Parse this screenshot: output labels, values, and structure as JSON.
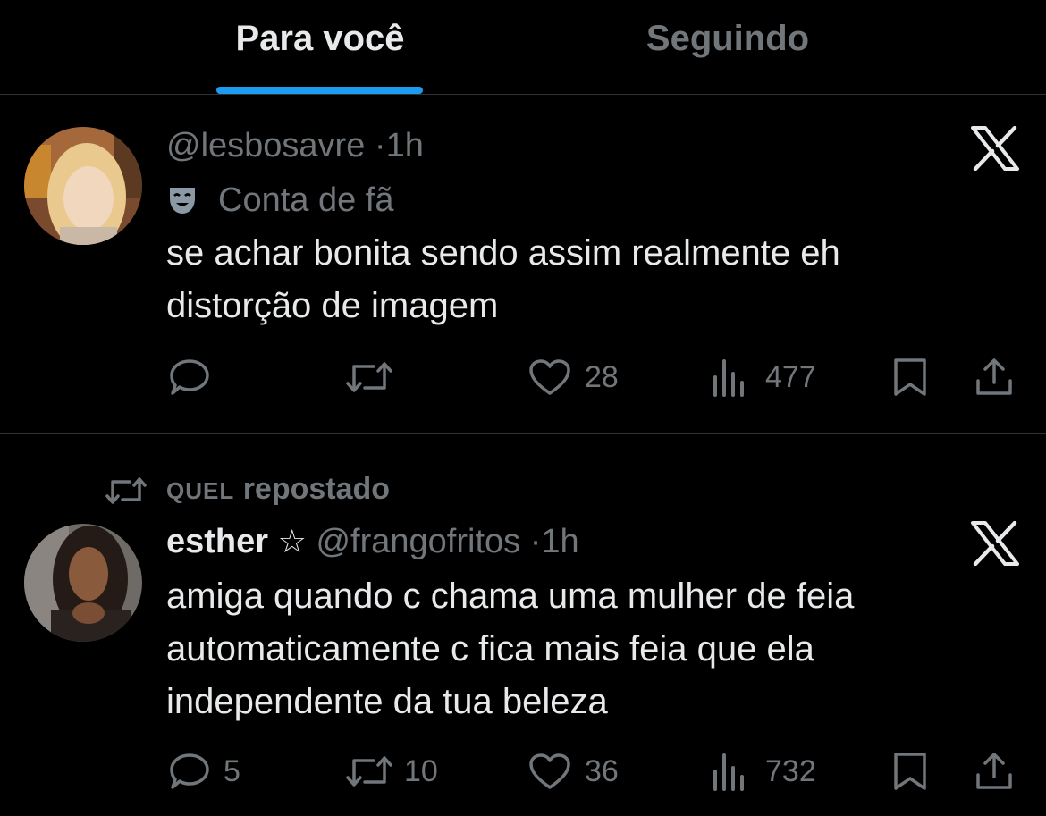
{
  "tabs": {
    "for_you": "Para você",
    "following": "Seguindo"
  },
  "colors": {
    "accent": "#1d9bf0",
    "muted": "#71767b",
    "text": "#e7e9ea",
    "background": "#000000"
  },
  "tweets": [
    {
      "handle": "@lesbosavre",
      "separator": "·",
      "time": "1h",
      "label_icon": "theater-mask-icon",
      "label": "Conta de fã",
      "text_line1": "se achar bonita sendo assim realmente eh",
      "text_line2": "distorção de imagem",
      "replies": "",
      "retweets": "",
      "likes": "28",
      "views": "477"
    },
    {
      "reposted_by": "QUEL",
      "reposted_label": "repostado",
      "display_name": "esther",
      "star": "☆",
      "handle": "@frangofritos",
      "separator": "·",
      "time": "1h",
      "text_line1": "amiga quando c chama uma mulher de feia",
      "text_line2": "automaticamente c fica mais feia que ela",
      "text_line3": "independente da tua beleza",
      "replies": "5",
      "retweets": "10",
      "likes": "36",
      "views": "732"
    }
  ]
}
